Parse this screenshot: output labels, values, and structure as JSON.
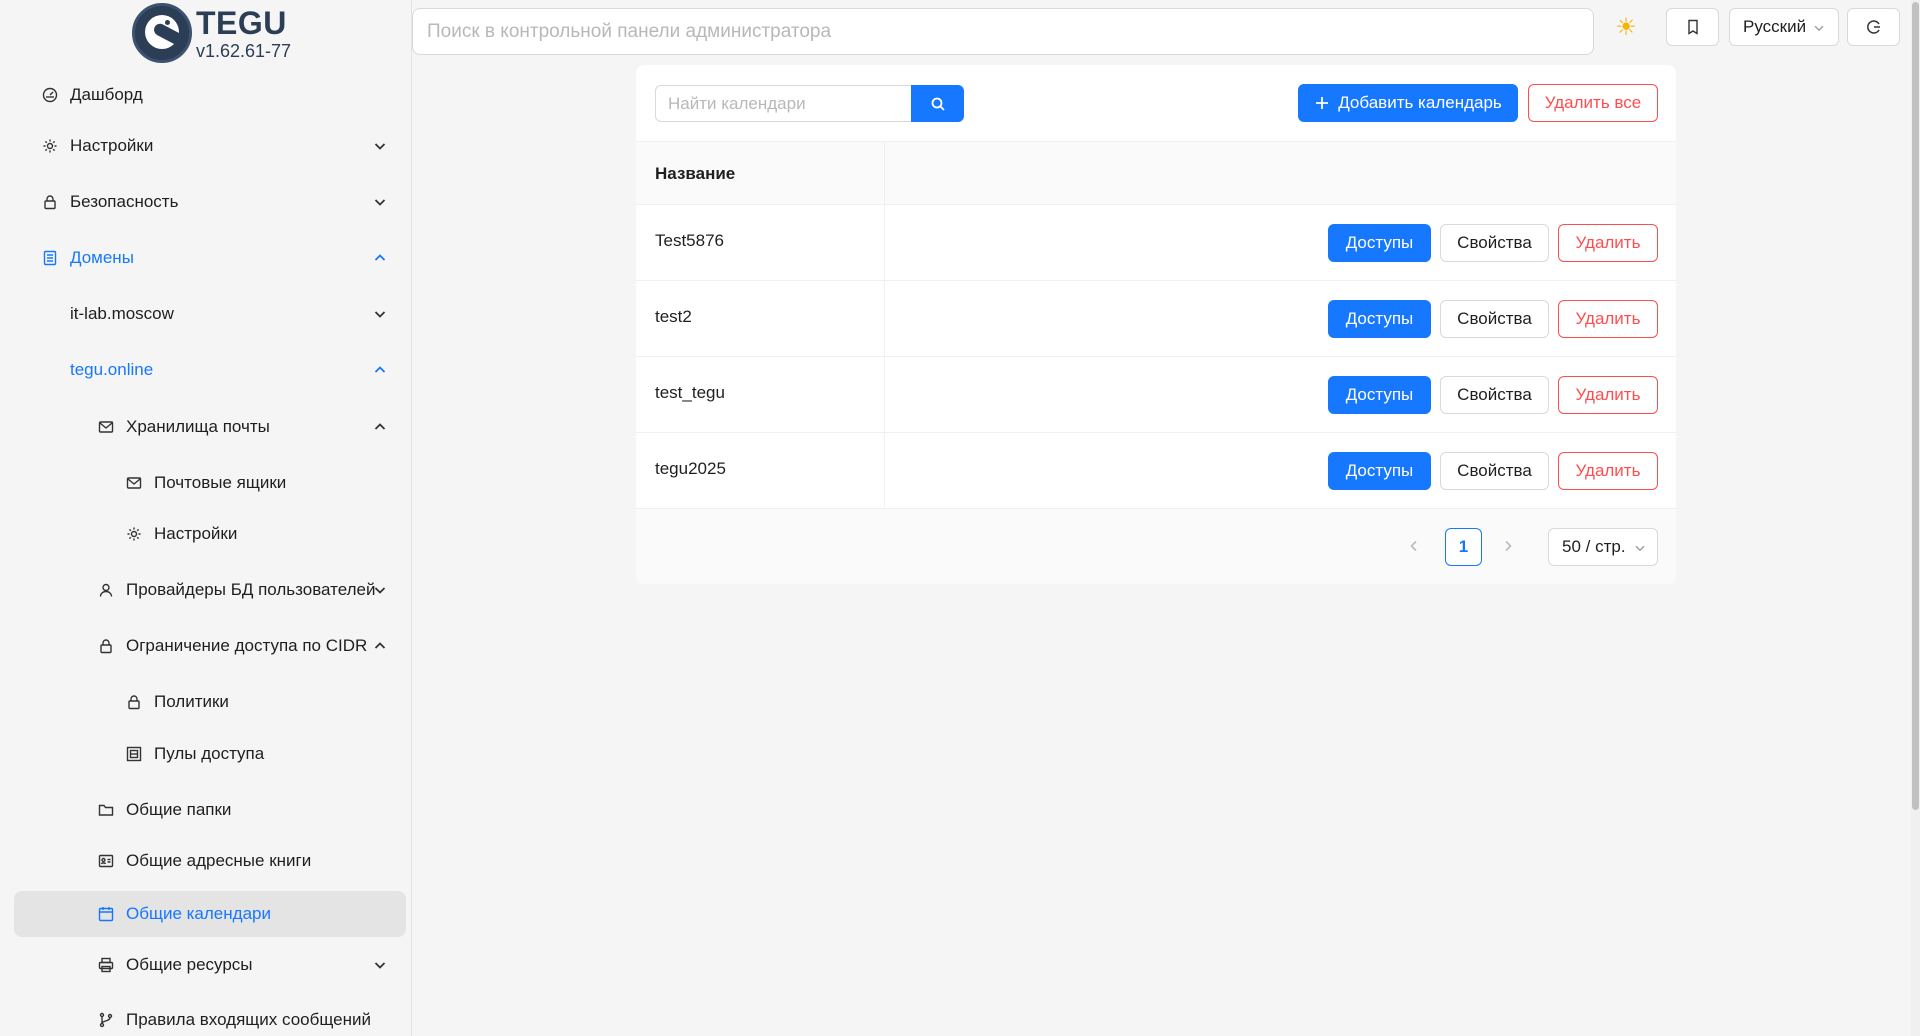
{
  "app": {
    "name": "TEGU",
    "version": "v1.62.61-77"
  },
  "header": {
    "search_placeholder": "Поиск в контрольной панели администратора",
    "theme_icon": "sun-icon",
    "language": "Русский"
  },
  "sidebar": {
    "items": [
      {
        "label": "Дашборд",
        "icon": "dashboard-icon"
      },
      {
        "label": "Настройки",
        "icon": "gear-icon"
      },
      {
        "label": "Безопасность",
        "icon": "lock-icon"
      },
      {
        "label": "Домены",
        "icon": "domains-icon"
      },
      {
        "label": "it-lab.moscow"
      },
      {
        "label": "tegu.online"
      },
      {
        "label": "Хранилища почты",
        "icon": "mail-icon"
      },
      {
        "label": "Почтовые ящики",
        "icon": "mail-icon"
      },
      {
        "label": "Настройки",
        "icon": "gear-icon"
      },
      {
        "label": "Провайдеры БД пользователей",
        "icon": "user-icon"
      },
      {
        "label": "Ограничение доступа по CIDR",
        "icon": "lock-icon"
      },
      {
        "label": "Политики",
        "icon": "lock-icon"
      },
      {
        "label": "Пулы доступа",
        "icon": "pool-icon"
      },
      {
        "label": "Общие папки",
        "icon": "folder-icon"
      },
      {
        "label": "Общие адресные книги",
        "icon": "contact-card-icon"
      },
      {
        "label": "Общие календари",
        "icon": "calendar-icon"
      },
      {
        "label": "Общие ресурсы",
        "icon": "printer-icon"
      },
      {
        "label": "Правила входящих сообщений",
        "icon": "branch-icon"
      }
    ]
  },
  "main": {
    "search_placeholder": "Найти календари",
    "add_label": "Добавить календарь",
    "delete_all_label": "Удалить все",
    "column_name": "Название",
    "rows": [
      {
        "name": "Test5876"
      },
      {
        "name": "test2"
      },
      {
        "name": "test_tegu"
      },
      {
        "name": "tegu2025"
      }
    ],
    "row_actions": {
      "access": "Доступы",
      "properties": "Свойства",
      "delete": "Удалить"
    },
    "pagination": {
      "current_page": "1",
      "page_size": "50 / стр."
    }
  },
  "colors": {
    "primary": "#1677ff",
    "danger": "#ff4d4f",
    "brand": "#2c3e55"
  }
}
